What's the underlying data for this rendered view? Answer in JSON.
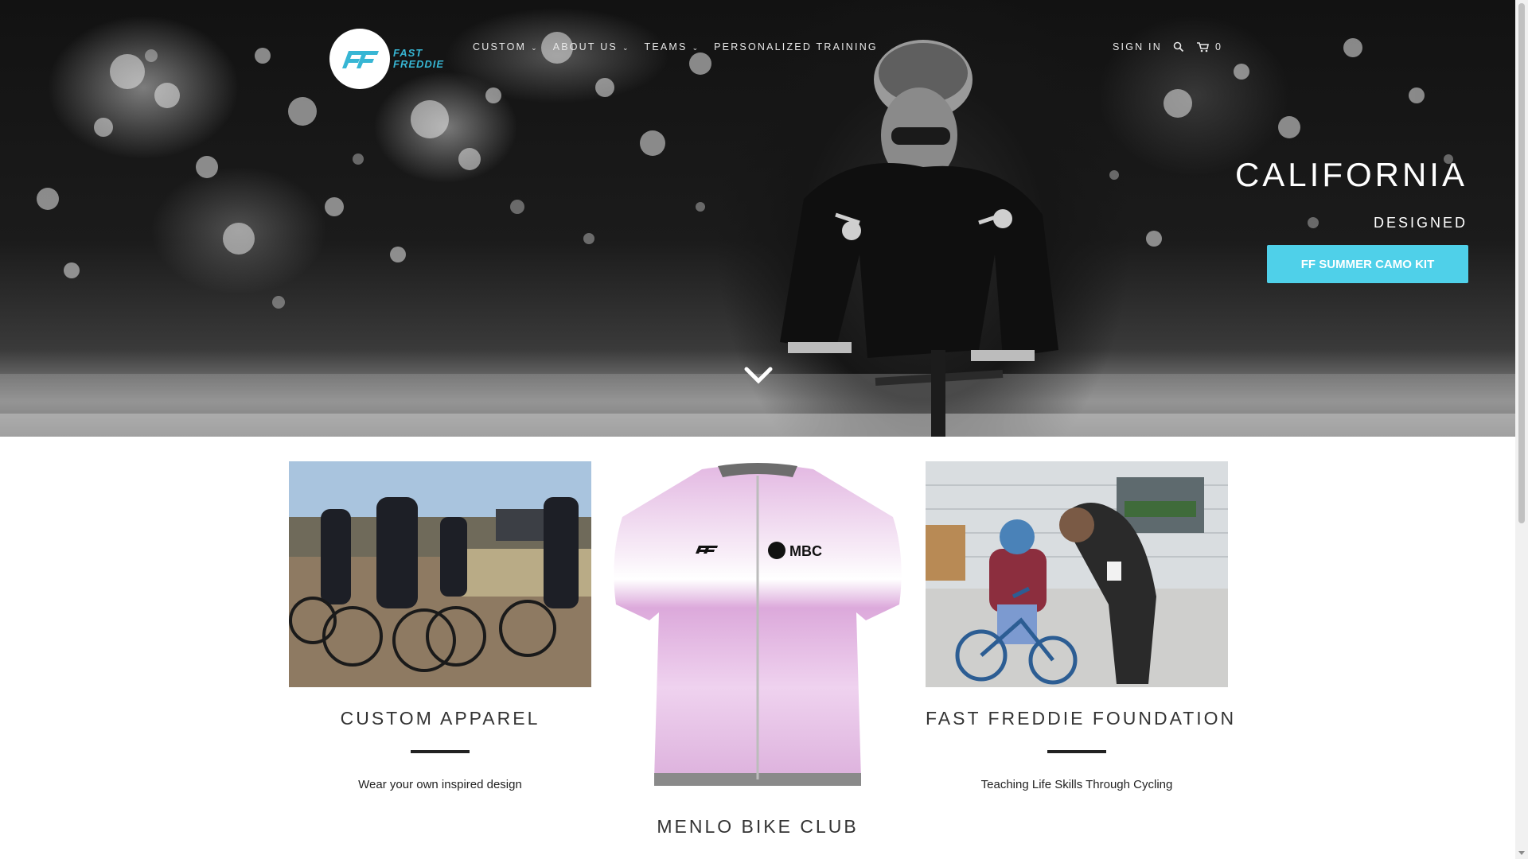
{
  "brand": {
    "logo_text_line1": "FAST",
    "logo_text_line2": "FREDDIE",
    "accent_color": "#4fd0e9",
    "logo_color": "#37b6d4"
  },
  "nav": {
    "items": [
      {
        "label": "CUSTOM",
        "has_dropdown": true
      },
      {
        "label": "ABOUT US",
        "has_dropdown": true
      },
      {
        "label": "TEAMS",
        "has_dropdown": true
      },
      {
        "label": "PERSONALIZED TRAINING",
        "has_dropdown": false
      }
    ],
    "sign_in": "SIGN IN",
    "search_icon": "search-icon",
    "cart_icon": "cart-icon",
    "cart_count": "0"
  },
  "hero": {
    "headline": "CALIFORNIA",
    "subheadline": "DESIGNED",
    "button_label": "FF SUMMER CAMO KIT",
    "scroll_icon": "chevron-down-icon"
  },
  "cards": [
    {
      "title": "CUSTOM APPAREL",
      "text": "Wear your own inspired design"
    },
    {
      "title": "MENLO BIKE CLUB",
      "text": "",
      "jersey_logo_right": "MBC"
    },
    {
      "title": "FAST FREDDIE FOUNDATION",
      "text": "Teaching Life Skills Through Cycling"
    }
  ]
}
